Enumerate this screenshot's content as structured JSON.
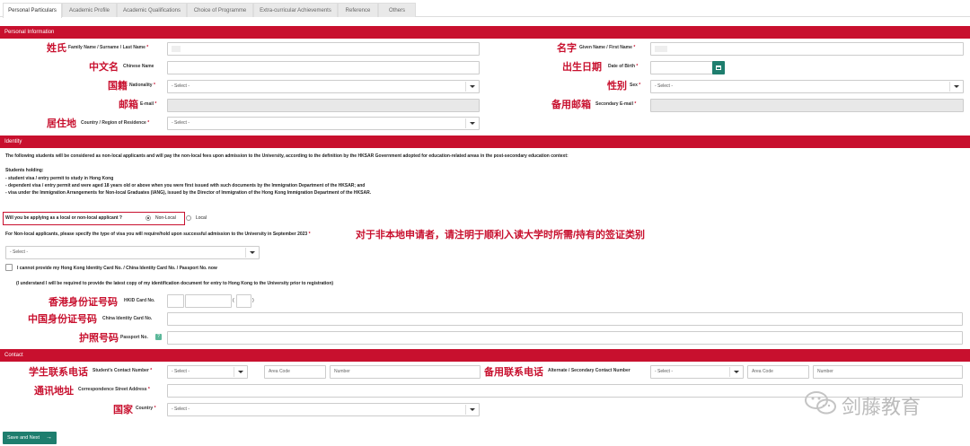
{
  "tabs": [
    {
      "label": "Personal Particulars",
      "active": true
    },
    {
      "label": "Academic Profile"
    },
    {
      "label": "Academic Qualifications"
    },
    {
      "label": "Choice of Programme"
    },
    {
      "label": "Extra-curricular Achievements"
    },
    {
      "label": "Reference"
    },
    {
      "label": "Others"
    }
  ],
  "sections": {
    "personal": "Personal Information",
    "identity": "Identity",
    "contact": "Contact"
  },
  "personal": {
    "family_name": {
      "cn": "姓氏",
      "en": "Family Name / Surname / Last Name",
      "req": "*"
    },
    "given_name": {
      "cn": "名字",
      "en": "Given Name / First Name",
      "req": "*"
    },
    "chinese_name": {
      "cn": "中文名",
      "en": "Chinese Name"
    },
    "dob": {
      "cn": "出生日期",
      "en": "Date of Birth",
      "req": "*"
    },
    "nationality": {
      "cn": "国籍",
      "en": "Nationality",
      "req": "*",
      "value": "- Select -"
    },
    "sex": {
      "cn": "性别",
      "en": "Sex",
      "req": "*",
      "value": "- Select -"
    },
    "email": {
      "cn": "邮箱",
      "en": "E-mail",
      "req": "*"
    },
    "secondary_email": {
      "cn": "备用邮箱",
      "en": "Secondary E-mail",
      "req": "*"
    },
    "country_residence": {
      "cn": "居住地",
      "en": "Country / Region of Residence",
      "req": "*",
      "value": "- Select -"
    }
  },
  "identity": {
    "intro": "The following students will be considered as non-local applicants and will pay the non-local fees upon admission to the University, according to the definition by the HKSAR Government adopted for education-related areas in the post-secondary education context:",
    "holding": "Students holding:",
    "bullets": [
      "-    student visa / entry permit to study in Hong Kong",
      "-    dependent visa / entry permit and were aged 18 years old or above when you were first issued with such documents by the Immigration Department of the HKSAR; and",
      "-    visa under the Immigration Arrangements for Non-local Graduates (IANG), issued by the Director of Immigration of the Hong Kong Immigration Department of the HKSAR."
    ],
    "question": "Will you be applying as a local or non-local applicant ?",
    "opt_nonlocal": "Non-Local",
    "opt_local": "Local",
    "visa_label": "For Non-local applicants, please specify the type of visa you will require/hold upon successful admission to the University in September 2023",
    "visa_req": "*",
    "visa_note_cn": "对于非本地申请者，请注明于顺利入读大学时所需/持有的签证类别",
    "visa_value": "- Select -",
    "cannot_provide": "I cannot provide my Hong Kong Identity Card No. / China Identity Card No. / Passport No. now",
    "understand": "(I understand I will be required to provide the latest copy of my identification document for entry to Hong Kong to the University prior to registration)",
    "hkid": {
      "cn": "香港身份证号码",
      "en": "HKID Card No.",
      "paren_open": "(",
      "paren_close": ")"
    },
    "china_id": {
      "cn": "中国身份证号码",
      "en": "China Identity Card No."
    },
    "passport": {
      "cn": "护照号码",
      "en": "Passport No.",
      "info": "?"
    }
  },
  "contact": {
    "student_number": {
      "cn": "学生联系电话",
      "en": "Student's Contact Number",
      "req": "*",
      "select": "- Select -",
      "area": "Area Code",
      "number": "Number"
    },
    "alt_number": {
      "cn": "备用联系电话",
      "en": "Alternate / Secondary Contact Number",
      "select": "- Select -",
      "area": "Area Code",
      "number": "Number"
    },
    "address": {
      "cn": "通讯地址",
      "en": "Correspondence Street Address",
      "req": "*"
    },
    "country": {
      "cn": "国家",
      "en": "Country",
      "req": "*",
      "value": "- Select -"
    }
  },
  "save_button": "Save and Next",
  "watermark": "剑藤教育",
  "colors": {
    "brand": "#c8102e",
    "button": "#1e7e6e"
  }
}
